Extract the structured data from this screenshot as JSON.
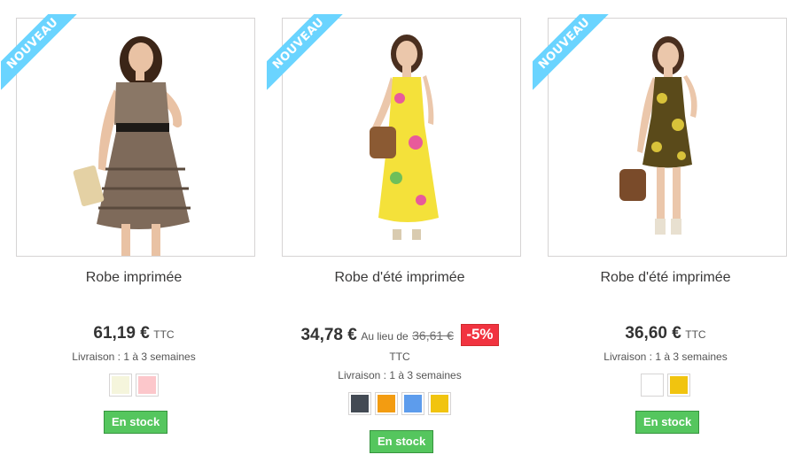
{
  "badge_label": "Nouveau",
  "products": [
    {
      "name": "Robe imprimée",
      "price": "61,19 €",
      "tax_label": "TTC",
      "delivery": "Livraison : 1 à 3 semaines",
      "colors": [
        "#f5f5dc",
        "#fcc7cb"
      ],
      "color_names": [
        "beige",
        "pink"
      ],
      "stock_label": "En stock"
    },
    {
      "name": "Robe d'été imprimée",
      "price": "34,78 €",
      "old_label": "Au lieu de",
      "old_price": "36,61 €",
      "reduction": "-5%",
      "tax_label": "TTC",
      "delivery": "Livraison : 1 à 3 semaines",
      "colors": [
        "#434a54",
        "#f39c11",
        "#5d9cec",
        "#f1c40f"
      ],
      "color_names": [
        "dark-grey",
        "orange",
        "blue",
        "yellow"
      ],
      "stock_label": "En stock"
    },
    {
      "name": "Robe d'été imprimée",
      "price": "36,60 €",
      "tax_label": "TTC",
      "delivery": "Livraison : 1 à 3 semaines",
      "colors": [
        "#ffffff",
        "#f1c40f"
      ],
      "color_names": [
        "white",
        "yellow"
      ],
      "stock_label": "En stock"
    }
  ]
}
